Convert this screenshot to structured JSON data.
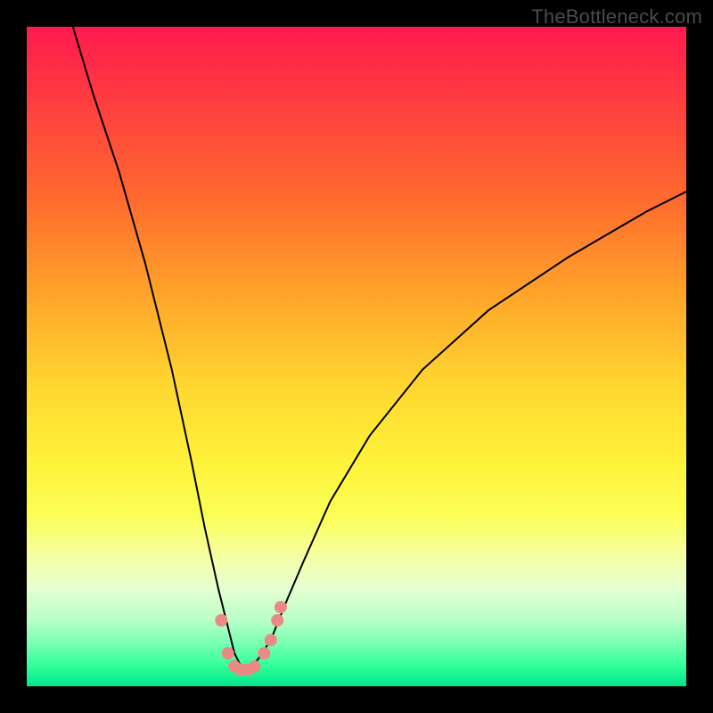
{
  "watermark": "TheBottleneck.com",
  "colors": {
    "frame": "#000000",
    "curve": "#000000",
    "dots": "#e98b84"
  },
  "chart_data": {
    "type": "line",
    "title": "",
    "xlabel": "",
    "ylabel": "",
    "xlim": [
      0,
      100
    ],
    "ylim": [
      0,
      100
    ],
    "series": [
      {
        "name": "bottleneck-curve",
        "x": [
          7,
          10,
          14,
          18,
          22,
          25,
          27,
          29,
          30.5,
          31.5,
          32.5,
          33.5,
          35,
          37,
          39,
          42,
          46,
          52,
          60,
          70,
          82,
          94,
          100
        ],
        "y": [
          100,
          90,
          78,
          64,
          48,
          34,
          24,
          15,
          9,
          5,
          3,
          3,
          4,
          7,
          12,
          19,
          28,
          38,
          48,
          57,
          65,
          72,
          75
        ]
      }
    ],
    "markers": [
      {
        "x": 29.5,
        "y": 10
      },
      {
        "x": 30.5,
        "y": 5
      },
      {
        "x": 31.5,
        "y": 3
      },
      {
        "x": 32.5,
        "y": 2.5
      },
      {
        "x": 33.5,
        "y": 2.5
      },
      {
        "x": 34.5,
        "y": 3
      },
      {
        "x": 36,
        "y": 5
      },
      {
        "x": 37,
        "y": 7
      },
      {
        "x": 38,
        "y": 10
      },
      {
        "x": 38.5,
        "y": 12
      }
    ],
    "gradient_stops": [
      {
        "pos": 0,
        "color": "#ff1a4d"
      },
      {
        "pos": 12,
        "color": "#ff3f3f"
      },
      {
        "pos": 26,
        "color": "#ff6a2e"
      },
      {
        "pos": 40,
        "color": "#ffa22a"
      },
      {
        "pos": 54,
        "color": "#ffd530"
      },
      {
        "pos": 66,
        "color": "#fff23a"
      },
      {
        "pos": 74,
        "color": "#fbff55"
      },
      {
        "pos": 80,
        "color": "#f6ffa0"
      },
      {
        "pos": 85,
        "color": "#e7ffd0"
      },
      {
        "pos": 90,
        "color": "#b8ffc8"
      },
      {
        "pos": 94,
        "color": "#6fffb0"
      },
      {
        "pos": 97,
        "color": "#2fff9a"
      },
      {
        "pos": 100,
        "color": "#00e68a"
      }
    ]
  }
}
